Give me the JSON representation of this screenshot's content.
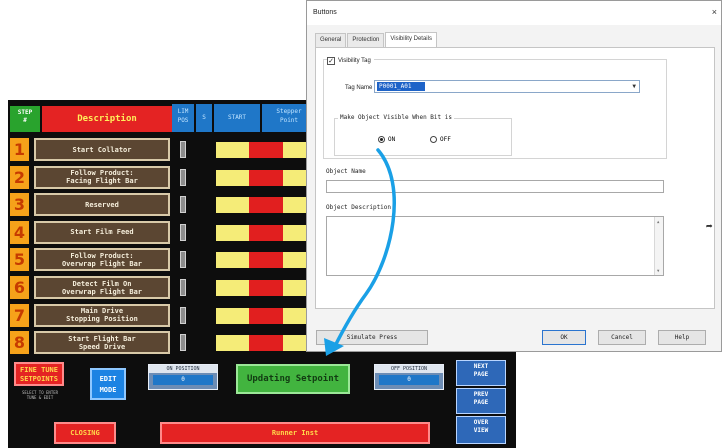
{
  "hmi": {
    "header": {
      "step_label": "STEP\n#",
      "description_label": "Description",
      "col_labels": [
        "LIM\nPOS",
        "S",
        "START",
        "Stepper\nPoint"
      ]
    },
    "rows": [
      {
        "num": "1",
        "desc": "Start Collator"
      },
      {
        "num": "2",
        "desc": "Follow Product:\nFacing Flight Bar"
      },
      {
        "num": "3",
        "desc": "Reserved"
      },
      {
        "num": "4",
        "desc": "Start Film Feed"
      },
      {
        "num": "5",
        "desc": "Follow Product:\nOverwrap Flight Bar"
      },
      {
        "num": "6",
        "desc": "Detect Film On\nOverwrap Flight Bar"
      },
      {
        "num": "7",
        "desc": "Main Drive\nStopping Position"
      },
      {
        "num": "8",
        "desc": "Start Flight Bar\nSpeed Drive"
      }
    ],
    "bottom": {
      "fine_tune_label": "FINE TUNE\nSETPOINTS",
      "fine_tune_note": "SELECT TO ENTER\nTUNE & EDIT",
      "edit_mode_label": "EDIT\nMODE",
      "on_position_label": "ON POSITION",
      "on_position_value": "0",
      "updating_label": "Updating Setpoint",
      "off_position_label": "OFF POSITION",
      "off_position_value": "0",
      "next_page_label": "NEXT\nPAGE",
      "prev_page_label": "PREV\nPAGE",
      "overview_label": "OVER\nVIEW",
      "closing_label": "CLOSING",
      "status_label": "Runner Inst"
    }
  },
  "dialog": {
    "title": "Buttons",
    "close_glyph": "×",
    "tabs": [
      "General",
      "Protection",
      "Visibility Details"
    ],
    "active_tab": 2,
    "visibility_tag_label": "Visibility Tag",
    "visibility_tag_checked": "✓",
    "tag_name_label": "Tag Name",
    "tag_name_value": "P0001_A01",
    "visible_when_label": "Make Object Visible When Bit is",
    "radio_on_label": "ON",
    "radio_off_label": "OFF",
    "object_name_label": "Object Name",
    "object_description_label": "Object Description",
    "simulate_button": "Simulate Press",
    "ok_button": "OK",
    "cancel_button": "Cancel",
    "help_button": "Help"
  },
  "colors": {
    "arrow": "#1aa0e6",
    "hmi_red": "#e42323",
    "hmi_yellow": "#f5ec78",
    "hmi_green": "#42b43f",
    "hmi_blue": "#1c83e3"
  }
}
